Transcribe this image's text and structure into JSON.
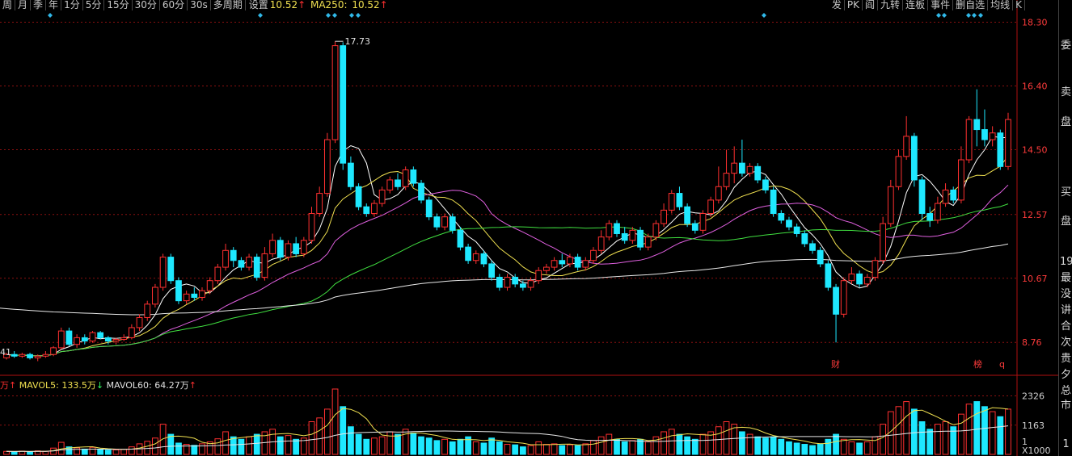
{
  "toolbar": {
    "periods": [
      "周",
      "月",
      "季",
      "年",
      "1分",
      "5分",
      "15分",
      "30分",
      "60分",
      "30s",
      "多周期"
    ],
    "settings_label": "设置",
    "price_now": "10.52",
    "ma_label": "MA250:",
    "ma_value": "10.52",
    "up_arrow": "↑"
  },
  "right_tools": [
    "发",
    "PK",
    "阎",
    "九转",
    "连板",
    "事件",
    "删自选",
    "均线",
    "K"
  ],
  "side_labels": [
    "委",
    "卖",
    "盘",
    "买",
    "盘",
    "19",
    "最",
    "没",
    "讲",
    "合",
    "次",
    "贵",
    "夕",
    "总",
    "市",
    "1"
  ],
  "price_axis": [
    "18.30",
    "16.40",
    "14.50",
    "12.57",
    "10.67",
    "8.76"
  ],
  "high_label": "17.73",
  "low_label": "41",
  "event_labels": {
    "cai": "财",
    "bang": "榜",
    "q": "q"
  },
  "vol_legend": {
    "prefix": "万↑",
    "mavol5_label": "MAVOL5:",
    "mavol5_value": "133.5万",
    "mavol5_dir": "↓",
    "mavol60_label": "MAVOL60:",
    "mavol60_value": "64.27万",
    "mavol60_dir": "↑"
  },
  "vol_axis": [
    "2326",
    "1163",
    "1",
    "X1000"
  ],
  "colors": {
    "up": "#ff3030",
    "down": "#1ee8ff",
    "ma5": "#ffffff",
    "ma10": "#f0e050",
    "ma20": "#e060e0",
    "ma60": "#40e040",
    "ma250": "#e8e8e8",
    "grid": "#8a1010"
  },
  "chart_data": {
    "type": "candlestick",
    "ylim": [
      7.9,
      18.6
    ],
    "vol_max": 2600,
    "candles": [
      [
        8.3,
        8.4,
        8.25,
        8.45
      ],
      [
        8.4,
        8.35,
        8.3,
        8.5
      ],
      [
        8.35,
        8.4,
        8.3,
        8.45
      ],
      [
        8.4,
        8.3,
        8.25,
        8.45
      ],
      [
        8.3,
        8.35,
        8.2,
        8.4
      ],
      [
        8.35,
        8.4,
        8.3,
        8.5
      ],
      [
        8.4,
        8.6,
        8.35,
        8.65
      ],
      [
        8.6,
        9.1,
        8.55,
        9.2
      ],
      [
        9.1,
        8.7,
        8.65,
        9.2
      ],
      [
        8.7,
        8.9,
        8.6,
        9.0
      ],
      [
        8.9,
        8.8,
        8.7,
        9.0
      ],
      [
        8.8,
        9.05,
        8.75,
        9.1
      ],
      [
        9.05,
        8.9,
        8.85,
        9.1
      ],
      [
        8.9,
        8.8,
        8.7,
        8.95
      ],
      [
        8.8,
        8.85,
        8.7,
        8.9
      ],
      [
        8.85,
        8.9,
        8.8,
        9.0
      ],
      [
        8.9,
        9.2,
        8.85,
        9.3
      ],
      [
        9.2,
        9.5,
        9.1,
        9.6
      ],
      [
        9.5,
        9.9,
        9.4,
        10.0
      ],
      [
        9.9,
        10.4,
        9.8,
        10.5
      ],
      [
        10.4,
        11.3,
        10.3,
        11.4
      ],
      [
        11.3,
        10.6,
        10.5,
        11.4
      ],
      [
        10.6,
        10.0,
        9.9,
        10.7
      ],
      [
        10.0,
        10.2,
        9.9,
        10.3
      ],
      [
        10.2,
        10.1,
        10.0,
        10.4
      ],
      [
        10.1,
        10.3,
        10.0,
        10.4
      ],
      [
        10.3,
        10.6,
        10.2,
        10.7
      ],
      [
        10.6,
        11.0,
        10.5,
        11.1
      ],
      [
        11.0,
        11.5,
        10.9,
        11.7
      ],
      [
        11.5,
        11.2,
        11.0,
        11.6
      ],
      [
        11.2,
        11.0,
        10.9,
        11.3
      ],
      [
        11.0,
        11.3,
        10.9,
        11.4
      ],
      [
        11.3,
        10.7,
        10.6,
        11.4
      ],
      [
        10.7,
        11.4,
        10.6,
        11.6
      ],
      [
        11.4,
        11.8,
        11.3,
        12.0
      ],
      [
        11.8,
        11.3,
        11.2,
        11.9
      ],
      [
        11.3,
        11.7,
        11.2,
        11.8
      ],
      [
        11.7,
        11.4,
        11.3,
        11.9
      ],
      [
        11.4,
        11.8,
        11.3,
        11.9
      ],
      [
        11.8,
        12.6,
        11.7,
        12.8
      ],
      [
        12.6,
        13.2,
        12.5,
        13.4
      ],
      [
        13.2,
        14.8,
        13.1,
        15.0
      ],
      [
        14.8,
        17.6,
        14.7,
        17.73
      ],
      [
        17.6,
        14.1,
        13.9,
        17.7
      ],
      [
        14.1,
        13.4,
        13.3,
        14.3
      ],
      [
        13.4,
        12.8,
        12.7,
        13.5
      ],
      [
        12.8,
        12.6,
        12.5,
        12.9
      ],
      [
        12.6,
        12.9,
        12.5,
        13.0
      ],
      [
        12.9,
        13.3,
        12.8,
        13.4
      ],
      [
        13.3,
        13.6,
        13.2,
        13.7
      ],
      [
        13.6,
        13.4,
        13.3,
        13.8
      ],
      [
        13.4,
        13.9,
        13.3,
        14.0
      ],
      [
        13.9,
        13.5,
        13.4,
        14.0
      ],
      [
        13.5,
        13.0,
        12.9,
        13.6
      ],
      [
        13.0,
        12.5,
        12.4,
        13.1
      ],
      [
        12.5,
        12.2,
        12.1,
        12.6
      ],
      [
        12.2,
        12.5,
        12.1,
        12.6
      ],
      [
        12.5,
        12.1,
        12.0,
        12.6
      ],
      [
        12.1,
        11.6,
        11.5,
        12.2
      ],
      [
        11.6,
        11.2,
        11.1,
        11.7
      ],
      [
        11.2,
        11.4,
        11.1,
        11.5
      ],
      [
        11.4,
        11.1,
        11.0,
        11.5
      ],
      [
        11.1,
        10.7,
        10.6,
        11.2
      ],
      [
        10.7,
        10.4,
        10.3,
        10.8
      ],
      [
        10.4,
        10.7,
        10.3,
        10.8
      ],
      [
        10.7,
        10.5,
        10.4,
        10.8
      ],
      [
        10.5,
        10.4,
        10.3,
        10.6
      ],
      [
        10.4,
        10.6,
        10.3,
        10.7
      ],
      [
        10.6,
        10.9,
        10.5,
        11.0
      ],
      [
        10.9,
        11.0,
        10.8,
        11.1
      ],
      [
        11.0,
        11.2,
        10.9,
        11.3
      ],
      [
        11.2,
        11.1,
        11.0,
        11.4
      ],
      [
        11.1,
        11.3,
        11.0,
        11.4
      ],
      [
        11.3,
        11.0,
        10.9,
        11.4
      ],
      [
        11.0,
        11.2,
        10.9,
        11.3
      ],
      [
        11.2,
        11.5,
        11.1,
        11.6
      ],
      [
        11.5,
        11.9,
        11.4,
        12.1
      ],
      [
        11.9,
        12.3,
        11.8,
        12.4
      ],
      [
        12.3,
        12.0,
        11.9,
        12.4
      ],
      [
        12.0,
        11.8,
        11.7,
        12.2
      ],
      [
        11.8,
        12.1,
        11.7,
        12.2
      ],
      [
        12.1,
        11.6,
        11.5,
        12.2
      ],
      [
        11.6,
        11.9,
        11.5,
        12.0
      ],
      [
        11.9,
        12.3,
        11.8,
        12.4
      ],
      [
        12.3,
        12.7,
        12.2,
        12.9
      ],
      [
        12.7,
        13.2,
        12.6,
        13.3
      ],
      [
        13.2,
        12.8,
        12.7,
        13.4
      ],
      [
        12.8,
        12.3,
        12.2,
        12.9
      ],
      [
        12.3,
        12.1,
        12.0,
        12.4
      ],
      [
        12.1,
        12.6,
        12.0,
        12.7
      ],
      [
        12.6,
        13.0,
        12.5,
        13.1
      ],
      [
        13.0,
        13.4,
        12.9,
        14.0
      ],
      [
        13.4,
        13.8,
        13.3,
        14.5
      ],
      [
        13.8,
        14.1,
        13.5,
        14.6
      ],
      [
        14.1,
        13.8,
        13.7,
        14.8
      ],
      [
        13.8,
        14.0,
        13.7,
        14.1
      ],
      [
        14.0,
        13.6,
        13.5,
        14.1
      ],
      [
        13.6,
        13.3,
        13.2,
        13.7
      ],
      [
        13.3,
        12.6,
        12.5,
        13.4
      ],
      [
        12.6,
        12.4,
        12.3,
        12.7
      ],
      [
        12.4,
        12.2,
        12.1,
        12.5
      ],
      [
        12.2,
        12.0,
        11.9,
        12.3
      ],
      [
        12.0,
        11.7,
        11.6,
        12.1
      ],
      [
        11.7,
        11.5,
        11.4,
        11.8
      ],
      [
        11.5,
        11.1,
        11.0,
        11.6
      ],
      [
        11.1,
        10.4,
        10.3,
        11.2
      ],
      [
        10.4,
        9.6,
        8.76,
        10.5
      ],
      [
        9.6,
        10.6,
        9.5,
        10.7
      ],
      [
        10.6,
        10.8,
        10.5,
        11.0
      ],
      [
        10.8,
        10.5,
        10.4,
        10.9
      ],
      [
        10.5,
        10.7,
        10.4,
        10.8
      ],
      [
        10.7,
        11.2,
        10.6,
        11.3
      ],
      [
        11.2,
        12.3,
        11.1,
        12.5
      ],
      [
        12.3,
        13.4,
        12.2,
        13.6
      ],
      [
        13.4,
        14.3,
        13.3,
        14.5
      ],
      [
        14.3,
        14.9,
        14.2,
        15.5
      ],
      [
        14.9,
        13.6,
        13.4,
        15.0
      ],
      [
        13.6,
        12.6,
        12.4,
        13.7
      ],
      [
        12.6,
        12.4,
        12.2,
        12.8
      ],
      [
        12.4,
        12.9,
        12.3,
        13.1
      ],
      [
        12.9,
        13.3,
        12.8,
        13.5
      ],
      [
        13.3,
        13.0,
        12.9,
        13.4
      ],
      [
        13.0,
        14.2,
        12.9,
        14.6
      ],
      [
        14.2,
        15.4,
        14.1,
        15.5
      ],
      [
        15.4,
        15.1,
        14.6,
        16.3
      ],
      [
        15.1,
        14.8,
        14.6,
        15.7
      ],
      [
        14.8,
        15.0,
        14.6,
        15.2
      ],
      [
        15.0,
        14.0,
        13.9,
        15.1
      ],
      [
        14.0,
        15.4,
        13.9,
        15.6
      ]
    ],
    "volumes": [
      120,
      110,
      130,
      100,
      140,
      120,
      250,
      480,
      300,
      260,
      210,
      280,
      200,
      170,
      180,
      200,
      300,
      420,
      520,
      650,
      1200,
      800,
      450,
      400,
      360,
      420,
      500,
      620,
      900,
      700,
      600,
      700,
      800,
      900,
      1000,
      700,
      750,
      600,
      650,
      1300,
      1450,
      1800,
      2700,
      1900,
      1100,
      800,
      600,
      650,
      700,
      900,
      800,
      1000,
      850,
      700,
      650,
      550,
      600,
      500,
      600,
      700,
      500,
      450,
      650,
      500,
      400,
      380,
      300,
      350,
      500,
      400,
      420,
      350,
      380,
      350,
      420,
      550,
      700,
      800,
      600,
      500,
      550,
      600,
      500,
      700,
      900,
      1000,
      800,
      700,
      600,
      800,
      900,
      1100,
      1300,
      1200,
      900,
      800,
      700,
      650,
      700,
      600,
      500,
      450,
      400,
      350,
      420,
      600,
      800,
      600,
      500,
      450,
      500,
      700,
      1200,
      1700,
      1900,
      2100,
      1800,
      1300,
      1000,
      1200,
      1300,
      1100,
      1600,
      2000,
      2100,
      1900,
      1700,
      1500,
      1800
    ],
    "ma_start_value": 9.78
  }
}
